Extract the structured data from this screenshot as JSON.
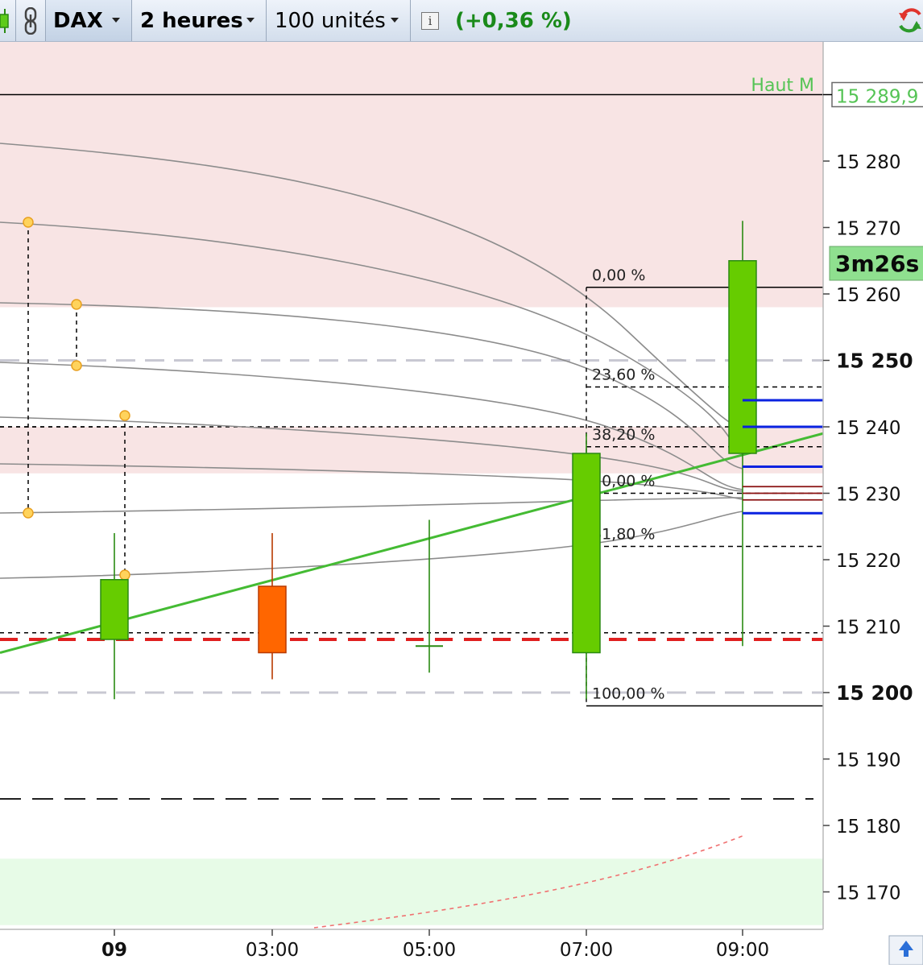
{
  "toolbar": {
    "instrument": "DAX",
    "period": "2 heures",
    "quantity": "100 unités",
    "change": "(+0,36 %)",
    "colors": {
      "change": "#1a8a1a"
    }
  },
  "chart_data": {
    "type": "candlestick",
    "title": "",
    "xlabel": "",
    "ylabel": "",
    "ylim": [
      15165,
      15300
    ],
    "x_tick_labels": [
      "09",
      "03:00",
      "05:00",
      "07:00",
      "09:00"
    ],
    "y_tick_labels": [
      "15 280",
      "15 270",
      "15 260",
      "15 250",
      "15 240",
      "15 230",
      "15 220",
      "15 210",
      "15 200",
      "15 190",
      "15 180",
      "15 170"
    ],
    "y_bold_ticks": [
      "15 250",
      "15 200"
    ],
    "last_price_label": "15 289,9",
    "countdown_label": "3m26s",
    "high_label": "Haut M",
    "grid": false,
    "candles": [
      {
        "time": "09",
        "open": 15208,
        "high": 15224,
        "low": 15199,
        "close": 15217,
        "color": "#66cc00"
      },
      {
        "time": "03:00",
        "open": 15216,
        "high": 15224,
        "low": 15202,
        "close": 15206,
        "color": "#ff6600"
      },
      {
        "time": "05:00",
        "open": 15207,
        "high": 15226,
        "low": 15203,
        "close": 15207,
        "color": "#66cc00"
      },
      {
        "time": "07:00",
        "open": 15206,
        "high": 15239,
        "low": 15199,
        "close": 15236,
        "color": "#66cc00"
      },
      {
        "time": "09:00",
        "open": 15236,
        "high": 15271,
        "low": 15207,
        "close": 15265,
        "color": "#66cc00"
      }
    ],
    "fibonacci": {
      "high": 15261,
      "low": 15198,
      "levels": [
        {
          "label": "0,00 %",
          "value": 15261
        },
        {
          "label": "23,60 %",
          "value": 15246
        },
        {
          "label": "38,20 %",
          "value": 15237
        },
        {
          "label": "50,00 %",
          "value": 15230
        },
        {
          "label": "61,80 %",
          "value": 15222
        },
        {
          "label": "100,00 %",
          "value": 15198
        }
      ]
    },
    "horizontal_lines": [
      {
        "value": 15290,
        "style": "solid",
        "color": "#000000"
      },
      {
        "value": 15250,
        "style": "dashed",
        "color": "#c8c8d2"
      },
      {
        "value": 15200,
        "style": "dashed",
        "color": "#c8c8d2"
      },
      {
        "value": 15240,
        "style": "dotted",
        "color": "#000000"
      },
      {
        "value": 15209,
        "style": "dotted",
        "color": "#000000"
      },
      {
        "value": 15208,
        "style": "dashed",
        "color": "#e02020"
      },
      {
        "value": 15184,
        "style": "dashed",
        "color": "#000000"
      }
    ],
    "zones": [
      {
        "from": 15258,
        "to": 15300,
        "color": "#f8e4e4"
      },
      {
        "from": 15233,
        "to": 15240,
        "color": "#f8e4e4"
      },
      {
        "from": 15165,
        "to": 15175,
        "color": "#e7fbe7"
      }
    ],
    "trendline": {
      "from": [
        0,
        15206
      ],
      "to": [
        1022,
        15239
      ],
      "color": "#44bb33"
    },
    "blue_marks": [
      15244,
      15240,
      15234,
      15227
    ],
    "dark_red_marks": [
      15231,
      15230,
      15229
    ]
  }
}
